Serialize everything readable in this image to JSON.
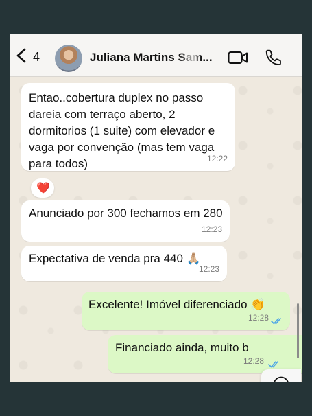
{
  "header": {
    "unread_count": "4",
    "contact_name": "Juliana Martins Sam..."
  },
  "messages": [
    {
      "direction": "incoming",
      "text": "Entao..cobertura duplex no passo dareia com terraço aberto, 2 dormitorios (1 suite) com elevador e vaga por convenção (mas tem vaga para todos)",
      "time": "12:22",
      "reaction": "❤️"
    },
    {
      "direction": "incoming",
      "text": "Anunciado por 300 fechamos em 280",
      "time": "12:23"
    },
    {
      "direction": "incoming",
      "text": "Expectativa de venda pra 440 🙏🏼",
      "time": "12:23"
    },
    {
      "direction": "outgoing",
      "text": "Excelente! Imóvel diferenciado 👏",
      "time": "12:28"
    },
    {
      "direction": "outgoing",
      "text": "Financiado ainda, muito b",
      "time": "12:28"
    }
  ],
  "icons": {
    "back": "chevron-left-icon",
    "video": "video-camera-icon",
    "call": "phone-icon",
    "scroll": "chevron-down-icon",
    "read": "double-check-icon"
  },
  "colors": {
    "incoming_bubble": "#ffffff",
    "outgoing_bubble": "#dcf8c6",
    "read_ticks": "#4fa6e7",
    "heart": "#e0282e"
  }
}
